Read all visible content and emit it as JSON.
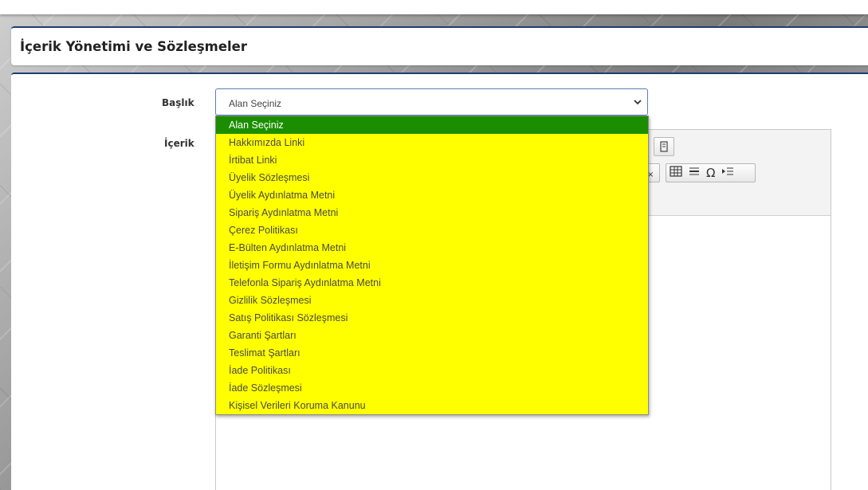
{
  "page": {
    "title": "İçerik Yönetimi ve Sözleşmeler"
  },
  "form": {
    "baslik_label": "Başlık",
    "icerik_label": "İçerik",
    "select_value": "Alan Seçiniz"
  },
  "dropdown": {
    "options": [
      "Alan Seçiniz",
      "Hakkımızda Linki",
      "İrtibat Linki",
      "Üyelik Sözleşmesi",
      "Üyelik Aydınlatma Metni",
      "Sipariş Aydınlatma Metni",
      "Çerez Politikası",
      "E-Bülten Aydınlatma Metni",
      "İletişim Formu Aydınlatma Metni",
      "Telefonla Sipariş Aydınlatma Metni",
      "Gizlilik Sözleşmesi",
      "Satış Politikası Sözleşmesi",
      "Garanti Şartları",
      "Teslimat Şartları",
      "İade Politikası",
      "İade Sözleşmesi",
      "Kişisel Verileri Koruma Kanunu"
    ],
    "selected_index": 0,
    "colors": {
      "background": "#ffff00",
      "selected": "#1b8e00"
    }
  },
  "editor_toolbar": {
    "icons": [
      "template-icon",
      "remove-format-icon",
      "table-icon",
      "horizontal-line-icon",
      "special-char-icon",
      "indent-icon"
    ],
    "omega": "Ω"
  }
}
